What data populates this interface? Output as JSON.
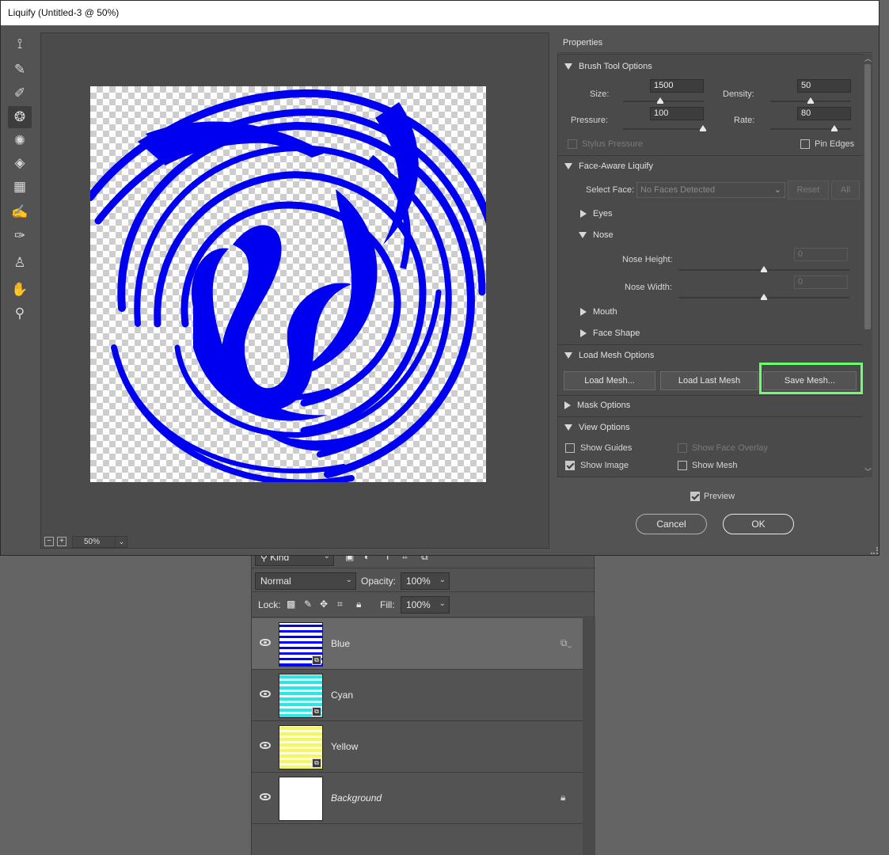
{
  "dialog": {
    "title": "Liquify (Untitled-3 @ 50%)",
    "zoom": "50%",
    "tools": [
      {
        "name": "forward-warp-icon",
        "glyph": "⟟"
      },
      {
        "name": "reconstruct-icon",
        "glyph": "✎"
      },
      {
        "name": "smooth-icon",
        "glyph": "✐"
      },
      {
        "name": "twirl-clockwise-icon",
        "glyph": "❂"
      },
      {
        "name": "pucker-icon",
        "glyph": "✺"
      },
      {
        "name": "bloat-icon",
        "glyph": "◈"
      },
      {
        "name": "push-left-icon",
        "glyph": "▦"
      },
      {
        "name": "freeze-mask-icon",
        "glyph": "✍"
      },
      {
        "name": "thaw-mask-icon",
        "glyph": "✑"
      },
      {
        "name": "face-tool-icon",
        "glyph": "♙"
      },
      {
        "name": "hand-icon",
        "glyph": "✋"
      },
      {
        "name": "zoom-icon",
        "glyph": "⚲"
      }
    ]
  },
  "properties": {
    "header": "Properties",
    "brush": {
      "title": "Brush Tool Options",
      "size_label": "Size:",
      "size_value": "1500",
      "density_label": "Density:",
      "density_value": "50",
      "pressure_label": "Pressure:",
      "pressure_value": "100",
      "rate_label": "Rate:",
      "rate_value": "80",
      "stylus_label": "Stylus Pressure",
      "pin_edges_label": "Pin Edges"
    },
    "face": {
      "title": "Face-Aware Liquify",
      "select_face_label": "Select Face:",
      "select_face_value": "No Faces Detected",
      "reset_label": "Reset",
      "all_label": "All",
      "eyes_label": "Eyes",
      "nose_label": "Nose",
      "nose_height_label": "Nose Height:",
      "nose_height_value": "0",
      "nose_width_label": "Nose Width:",
      "nose_width_value": "0",
      "mouth_label": "Mouth",
      "face_shape_label": "Face Shape"
    },
    "mesh": {
      "title": "Load Mesh Options",
      "load_label": "Load Mesh...",
      "load_last_label": "Load Last Mesh",
      "save_label": "Save Mesh..."
    },
    "mask": {
      "title": "Mask Options"
    },
    "view": {
      "title": "View Options",
      "show_guides": "Show Guides",
      "show_face_overlay": "Show Face Overlay",
      "show_image": "Show Image",
      "show_mesh": "Show Mesh"
    }
  },
  "footer": {
    "preview_label": "Preview",
    "cancel_label": "Cancel",
    "ok_label": "OK"
  },
  "layers": {
    "filter_kind": "Kind",
    "blend_mode": "Normal",
    "opacity_label": "Opacity:",
    "opacity_value": "100%",
    "lock_label": "Lock:",
    "fill_label": "Fill:",
    "fill_value": "100%",
    "items": [
      {
        "name": "Blue",
        "color": "#0000ff"
      },
      {
        "name": "Cyan",
        "color": "#2fe4e4"
      },
      {
        "name": "Yellow",
        "color": "#f5f56a"
      },
      {
        "name": "Background",
        "color": "#ffffff"
      }
    ]
  }
}
